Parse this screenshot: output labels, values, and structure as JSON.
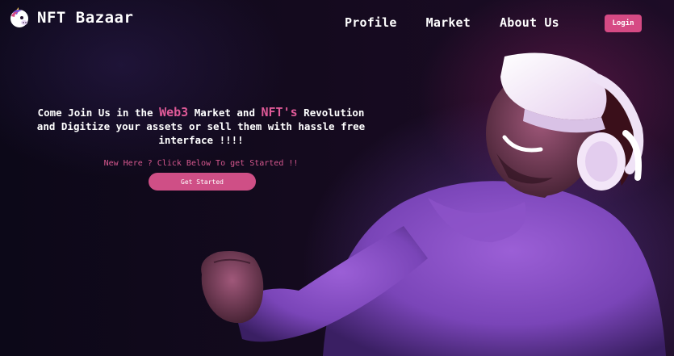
{
  "brand": {
    "name": "NFT Bazaar",
    "logo_icon": "unicorn-logo-icon"
  },
  "nav": {
    "items": [
      {
        "label": "Profile"
      },
      {
        "label": "Market"
      },
      {
        "label": "About Us"
      }
    ],
    "login_label": "Login"
  },
  "hero": {
    "line1_prefix": "Come Join Us in the ",
    "line1_accent1": "Web3",
    "line1_middle": " Market and ",
    "line1_accent2": "NFT's",
    "line1_suffix": " Revolution",
    "line2": "and Digitize your assets or sell them with hassle free",
    "line3": "interface !!!!",
    "tagline": "New Here ? Click Below To get Started !!",
    "cta_label": "Get Started"
  },
  "colors": {
    "accent": "#e05a98",
    "button": "#d64a84",
    "background": "#0b0612"
  }
}
